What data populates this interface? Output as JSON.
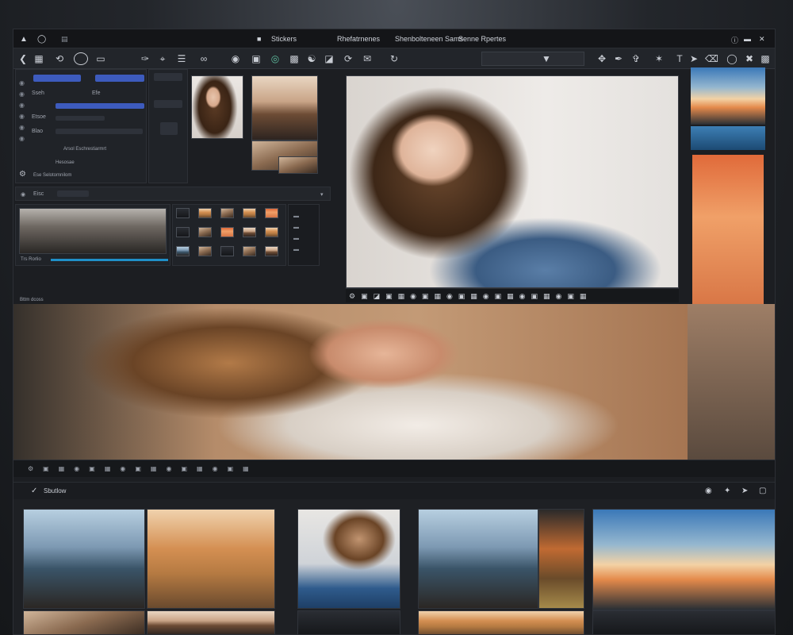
{
  "titlebar": {
    "app_label": "Stickers",
    "menu_items": [
      "Rhefatrnenes",
      "Shenbolteneen Sams",
      "Senne Rpertes"
    ]
  },
  "toolbar": {
    "left_icons": [
      "back-icon",
      "grid-icon",
      "loop-icon",
      "box-icon",
      "brush-icon",
      "crop-icon",
      "layers-icon",
      "link-icon",
      "eye-icon",
      "frame-icon",
      "target-icon",
      "refresh-icon"
    ],
    "right_icons": [
      "select-icon",
      "move-icon",
      "pen-icon",
      "brush-icon",
      "text-icon",
      "wand-icon",
      "erase-icon",
      "lasso-icon",
      "stamp-icon",
      "palette-icon",
      "close-icon"
    ]
  },
  "left_panel": {
    "rows": [
      {
        "label": "Sseh",
        "highlight": true
      },
      {
        "label": "Efe",
        "highlight": false
      },
      {
        "label": "Etsoe",
        "highlight": true
      },
      {
        "label": "Blao",
        "highlight": false
      },
      {
        "label": "Hesosae",
        "highlight": false
      },
      {
        "label": "Arsol Eschrestiarmrt",
        "highlight": false
      }
    ],
    "footer": "Ese Selotomnilom",
    "filter_label": "Eisc"
  },
  "filmstrip": {
    "caption": "Trs Rorlio"
  },
  "main": {
    "caption": "Bttm dcoss"
  },
  "library": {
    "label": "Sbutlow",
    "toolbar_icons": [
      "eye-icon",
      "sparkle-icon",
      "share-icon",
      "expand-icon"
    ]
  }
}
